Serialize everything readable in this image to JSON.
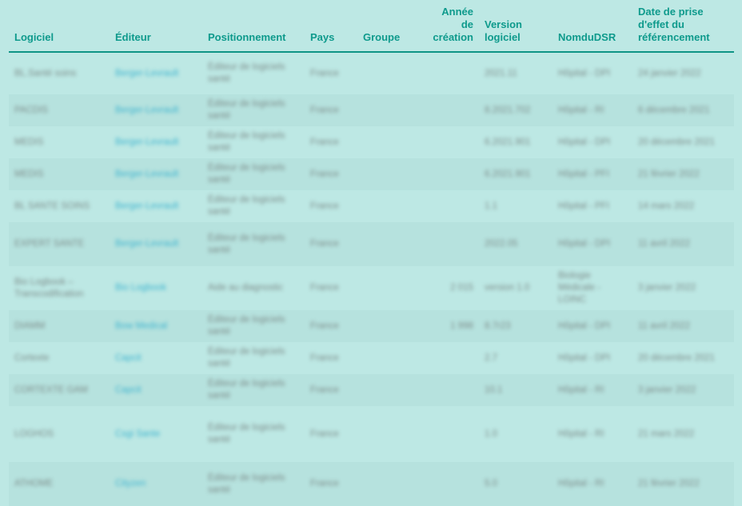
{
  "headers": [
    {
      "label": "Logiciel"
    },
    {
      "label": "Éditeur"
    },
    {
      "label": "Positionnement"
    },
    {
      "label": "Pays"
    },
    {
      "label": "Groupe"
    },
    {
      "label": "Année\nde\ncréation"
    },
    {
      "label": "Version\nlogiciel"
    },
    {
      "label": "NomduDSR"
    },
    {
      "label": "Date de prise\nd'effet du\nréférencement"
    }
  ],
  "rows": [
    [
      "BL.Santé soins",
      "Berger-Levrault",
      "Éditeur de logiciels santé",
      "France",
      "",
      "",
      "2021.11",
      "Hôpital - DPI",
      "24 janvier 2022"
    ],
    [
      "PACDIS",
      "Berger-Levrault",
      "Éditeur de logiciels santé",
      "France",
      "",
      "",
      "8.2021.702",
      "Hôpital - RI",
      "6 décembre 2021"
    ],
    [
      "MEDIS",
      "Berger-Levrault",
      "Éditeur de logiciels santé",
      "France",
      "",
      "",
      "6.2021.901",
      "Hôpital - DPI",
      "20 décembre 2021"
    ],
    [
      "MEDIS",
      "Berger-Levrault",
      "Éditeur de logiciels santé",
      "France",
      "",
      "",
      "6.2021.901",
      "Hôpital - PFI",
      "21 février 2022"
    ],
    [
      "BL SANTE SOINS",
      "Berger-Levrault",
      "Éditeur de logiciels santé",
      "France",
      "",
      "",
      "1.1",
      "Hôpital - PFI",
      "14 mars 2022"
    ],
    [
      "EXPERT SANTE",
      "Berger-Levrault",
      "Éditeur de logiciels santé",
      "France",
      "",
      "",
      "2022.05",
      "Hôpital - DPI",
      "11 avril 2022"
    ],
    [
      "Bio Logbook – Transcodification",
      "Bio Logbook",
      "Aide au diagnostic",
      "France",
      "",
      "2 015",
      "version 1.0",
      "Biologie Médicale - LOINC",
      "3 janvier 2022"
    ],
    [
      "DIAMM",
      "Bow Medical",
      "Éditeur de logiciels santé",
      "France",
      "",
      "1 998",
      "8.7r23",
      "Hôpital - DPI",
      "11 avril 2022"
    ],
    [
      "Cortexte",
      "Capcit",
      "Éditeur de logiciels santé",
      "France",
      "",
      "",
      "2.7",
      "Hôpital - DPI",
      "20 décembre 2021"
    ],
    [
      "CORTEXTE GAM",
      "Capcit",
      "Éditeur de logiciels santé",
      "France",
      "",
      "",
      "10.1",
      "Hôpital - RI",
      "3 janvier 2022"
    ],
    [
      "LOGHOS",
      "Csgi Sante",
      "Éditeur de logiciels santé",
      "France",
      "",
      "",
      "1.0",
      "Hôpital - RI",
      "21 mars 2022"
    ],
    [
      "ATHOME",
      "Cityzen",
      "Éditeur de logiciels santé",
      "France",
      "",
      "",
      "5.0",
      "Hôpital - RI",
      "21 février 2022"
    ]
  ]
}
